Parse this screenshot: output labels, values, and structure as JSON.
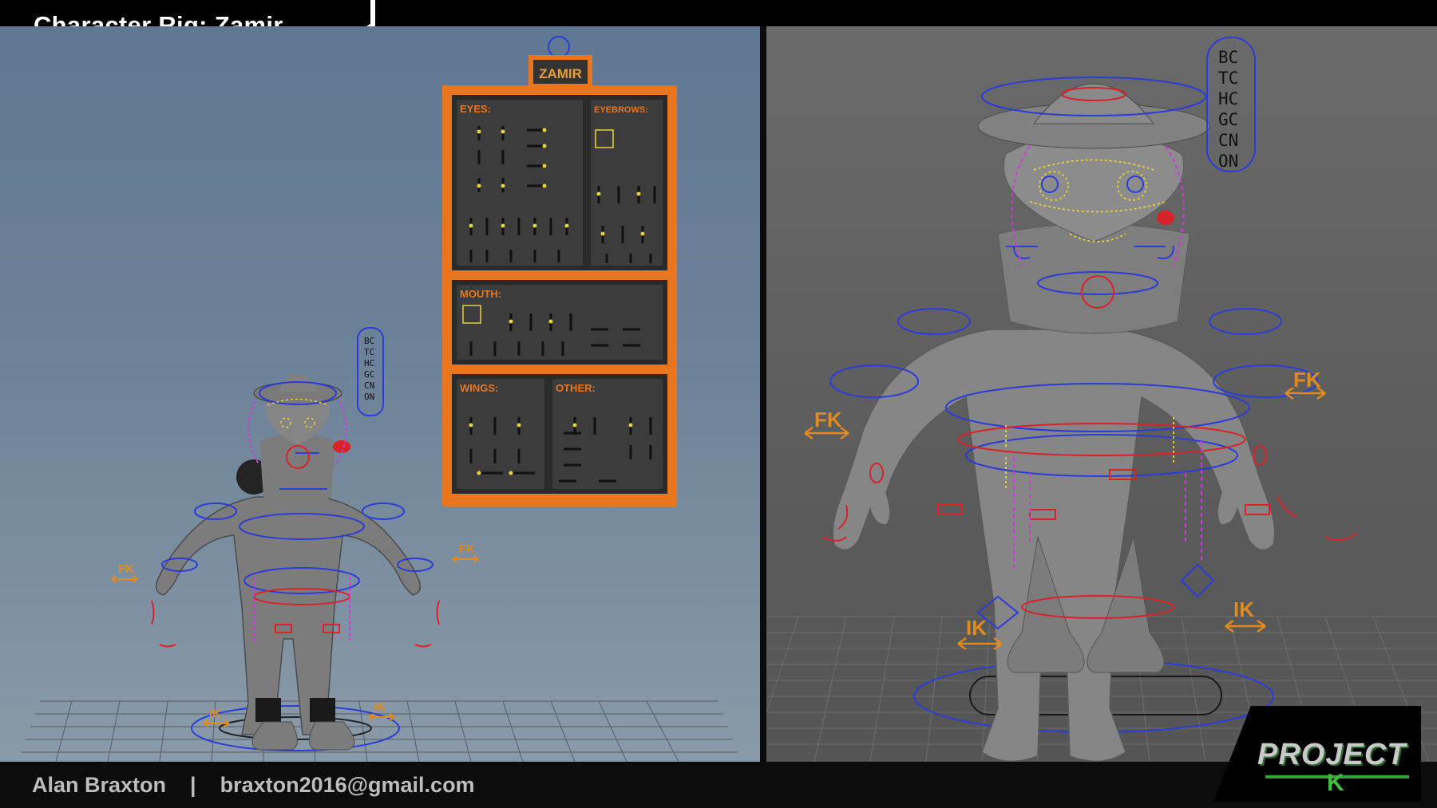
{
  "header": {
    "title": "Character Rig: Zamir"
  },
  "footer": {
    "author": "Alan Braxton",
    "separator": "|",
    "email": "braxton2016@gmail.com"
  },
  "logo": {
    "main": "PROJECT",
    "sub": "K"
  },
  "control_panel": {
    "name": "ZAMIR",
    "sections": {
      "eyes": "EYES:",
      "eyebrows": "EYEBROWS:",
      "mouth": "MOUTH:",
      "wings": "WINGS:",
      "other": "OTHER:"
    }
  },
  "controls": {
    "fk_label": "FK",
    "ik_label": "IK",
    "switcher_letters": [
      "BC",
      "TC",
      "HC",
      "GC",
      "CN",
      "ON"
    ]
  },
  "colors": {
    "panel_orange": "#e8761e",
    "ctrl_blue": "#2c3cd8",
    "ctrl_red": "#d8232a",
    "ctrl_magenta": "#c93cd6",
    "ctrl_yellow": "#e6d23a",
    "ctrl_orange": "#e08a22"
  }
}
